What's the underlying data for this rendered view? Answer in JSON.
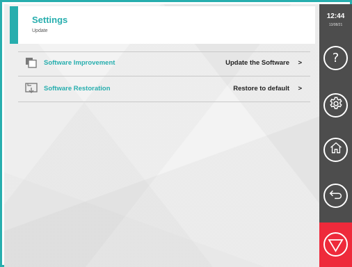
{
  "header": {
    "title": "Settings",
    "subtitle": "Update"
  },
  "menu": {
    "items": [
      {
        "label": "Software Improvement",
        "action": "Update the Software",
        "chevron": ">",
        "icon": "copy-icon"
      },
      {
        "label": "Software Restoration",
        "action": "Restore to default",
        "chevron": ">",
        "icon": "restore-icon"
      }
    ]
  },
  "side": {
    "time": "12:44",
    "date": "13/08/21",
    "buttons": [
      {
        "name": "help",
        "glyph": "?",
        "icon": "help-icon"
      },
      {
        "name": "settings",
        "icon": "gear-icon"
      },
      {
        "name": "home",
        "icon": "home-icon"
      },
      {
        "name": "back",
        "icon": "back-arrow-icon"
      },
      {
        "name": "stop",
        "icon": "stop-icon"
      }
    ]
  },
  "colors": {
    "accent": "#27aeae",
    "sidebar": "#4d4d4d",
    "stop": "#ee2a3b"
  }
}
